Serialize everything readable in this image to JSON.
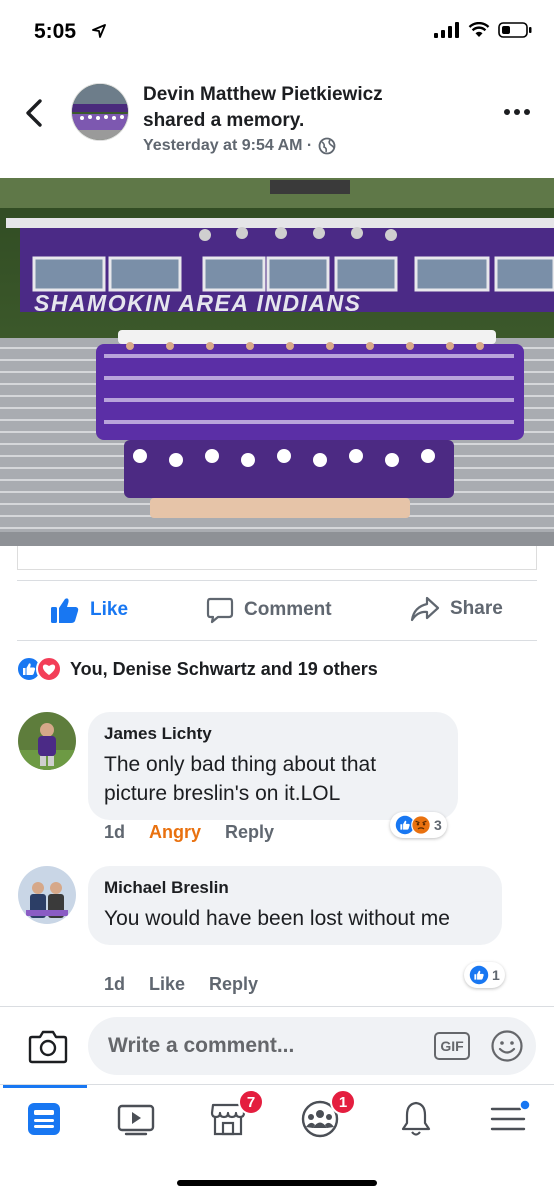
{
  "status": {
    "time": "5:05"
  },
  "post": {
    "author": "Devin Matthew Pietkiewicz",
    "action": "shared a memory.",
    "timestamp": "Yesterday at 9:54 AM ·",
    "photo_banner": "SHAMOKIN AREA INDIANS"
  },
  "actions": {
    "like": "Like",
    "comment": "Comment",
    "share": "Share"
  },
  "reactions": {
    "summary": "You, Denise Schwartz and 19 others",
    "colors": {
      "like": "#1877f2",
      "love": "#f33e58",
      "angry": "#e9710f"
    }
  },
  "comments": [
    {
      "name": "James Lichty",
      "text": "The only bad thing about that picture breslin's on it.LOL",
      "time": "1d",
      "reaction_label": "Angry",
      "reply": "Reply",
      "react_count": "3"
    },
    {
      "name": "Michael Breslin",
      "text": "You would have been lost without me",
      "time": "1d",
      "reaction_label": "Like",
      "reply": "Reply",
      "react_count": "1"
    }
  ],
  "composer": {
    "placeholder": "Write a comment...",
    "gif": "GIF"
  },
  "nav": {
    "items": [
      "news-feed-icon",
      "watch-icon",
      "marketplace-icon",
      "groups-icon",
      "notifications-icon",
      "menu-icon"
    ],
    "marketplace_badge": "7",
    "groups_badge": "1"
  },
  "theme": {
    "accent": "#1877f2",
    "text_secondary": "#606770",
    "bubble_bg": "#f0f2f5"
  }
}
